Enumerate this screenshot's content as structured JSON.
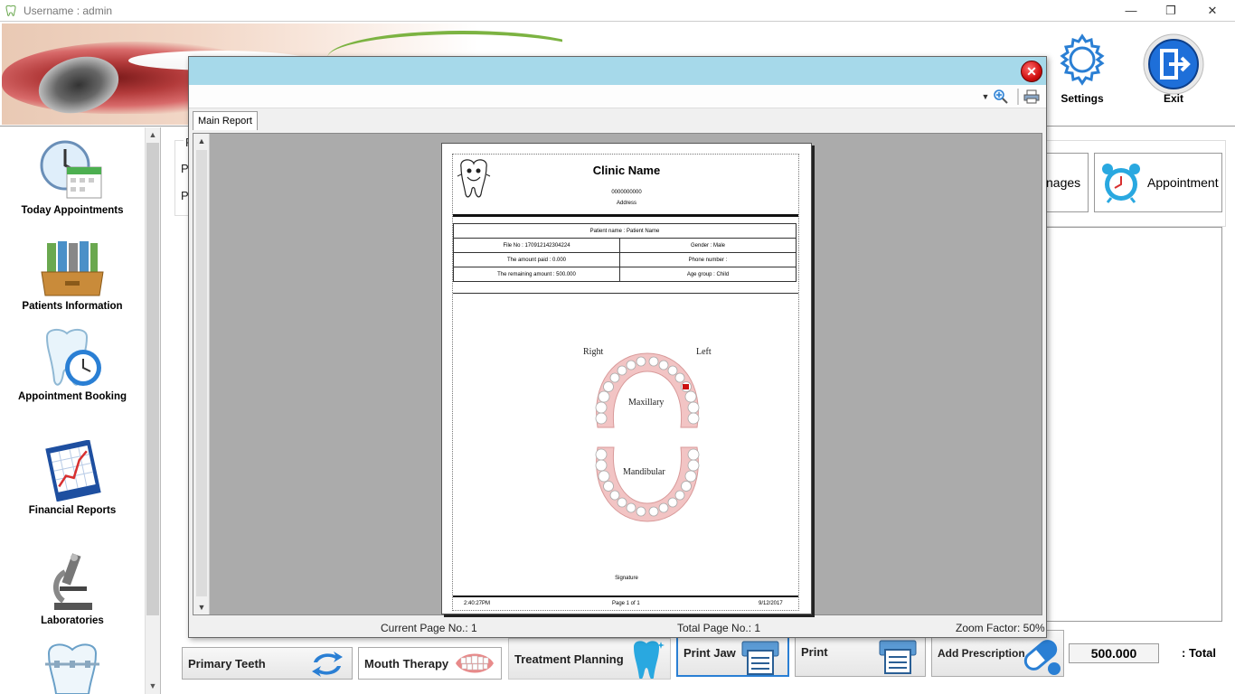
{
  "window": {
    "title": "Username : admin",
    "minimize": "—",
    "restore": "❐",
    "close": "✕"
  },
  "header": {
    "settings_label": "Settings",
    "exit_label": "Exit"
  },
  "sidebar": {
    "items": [
      {
        "label": "Today Appointments"
      },
      {
        "label": "Patients Information"
      },
      {
        "label": "Appointment Booking"
      },
      {
        "label": "Financial Reports"
      },
      {
        "label": "Laboratories"
      }
    ]
  },
  "background": {
    "group_letters": [
      "P",
      "P",
      "P"
    ],
    "tabs": [
      {
        "label": "nages"
      },
      {
        "label": "Appointment"
      }
    ],
    "total_value": "500.000",
    "total_label": ": Total",
    "bottom_buttons": [
      {
        "label": "Primary Teeth"
      },
      {
        "label": "Mouth Therapy"
      },
      {
        "label": "Treatment Planning"
      },
      {
        "label": "Print Jaw"
      },
      {
        "label": "Print"
      },
      {
        "label": "Add Prescription"
      }
    ]
  },
  "dialog": {
    "close_glyph": "✕",
    "tab_label": "Main Report",
    "status": {
      "current_page": "Current Page No.: 1",
      "total_page": "Total Page No.: 1",
      "zoom": "Zoom Factor: 50%"
    }
  },
  "report": {
    "clinic_name": "Clinic Name",
    "phone": "0000000000",
    "address": "Address",
    "patient_name": "Patient name : Patient  Name",
    "rows": [
      {
        "left": "File No : 170912142304224",
        "right": "Gender : Male"
      },
      {
        "left": "The amount paid : 0.000",
        "right": "Phone number :"
      },
      {
        "left": "The remaining amount : 500.000",
        "right": "Age group : Child"
      }
    ],
    "chart": {
      "right_label": "Right",
      "left_label": "Left",
      "upper_label": "Maxillary",
      "lower_label": "Mandibular"
    },
    "signature": "Signature",
    "footer": {
      "time": "2:40:27PM",
      "page": "Page 1 of 1",
      "date": "9/12/2017"
    }
  },
  "colors": {
    "dialog_title": "#a6d9ea",
    "viewer_bg": "#ababab",
    "close_red": "#d01010",
    "accent_blue": "#1e6fd9"
  }
}
